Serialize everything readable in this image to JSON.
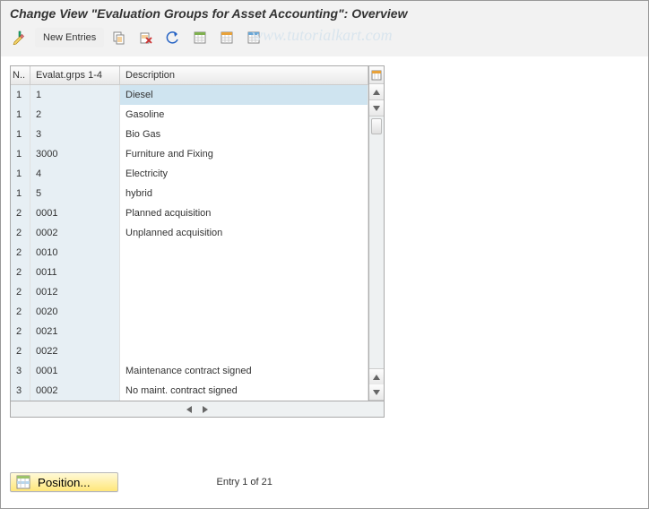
{
  "title": "Change View \"Evaluation Groups for Asset Accounting\": Overview",
  "toolbar": {
    "new_entries": "New Entries"
  },
  "watermark": "www.tutorialkart.com",
  "grid": {
    "headers": {
      "n": "N..",
      "grp": "Evalat.grps 1-4",
      "desc": "Description"
    },
    "rows": [
      {
        "n": "1",
        "grp": "1",
        "desc": "Diesel",
        "highlight": true
      },
      {
        "n": "1",
        "grp": "2",
        "desc": "Gasoline"
      },
      {
        "n": "1",
        "grp": "3",
        "desc": "Bio Gas"
      },
      {
        "n": "1",
        "grp": "3000",
        "desc": "Furniture and Fixing"
      },
      {
        "n": "1",
        "grp": "4",
        "desc": "Electricity"
      },
      {
        "n": "1",
        "grp": "5",
        "desc": "hybrid"
      },
      {
        "n": "2",
        "grp": "0001",
        "desc": "Planned acquisition"
      },
      {
        "n": "2",
        "grp": "0002",
        "desc": "Unplanned acquisition"
      },
      {
        "n": "2",
        "grp": "0010",
        "desc": ""
      },
      {
        "n": "2",
        "grp": "0011",
        "desc": ""
      },
      {
        "n": "2",
        "grp": "0012",
        "desc": ""
      },
      {
        "n": "2",
        "grp": "0020",
        "desc": ""
      },
      {
        "n": "2",
        "grp": "0021",
        "desc": ""
      },
      {
        "n": "2",
        "grp": "0022",
        "desc": ""
      },
      {
        "n": "3",
        "grp": "0001",
        "desc": "Maintenance contract signed"
      },
      {
        "n": "3",
        "grp": "0002",
        "desc": "No maint. contract signed"
      }
    ]
  },
  "footer": {
    "position_label": "Position...",
    "entry_text": "Entry 1 of 21"
  }
}
